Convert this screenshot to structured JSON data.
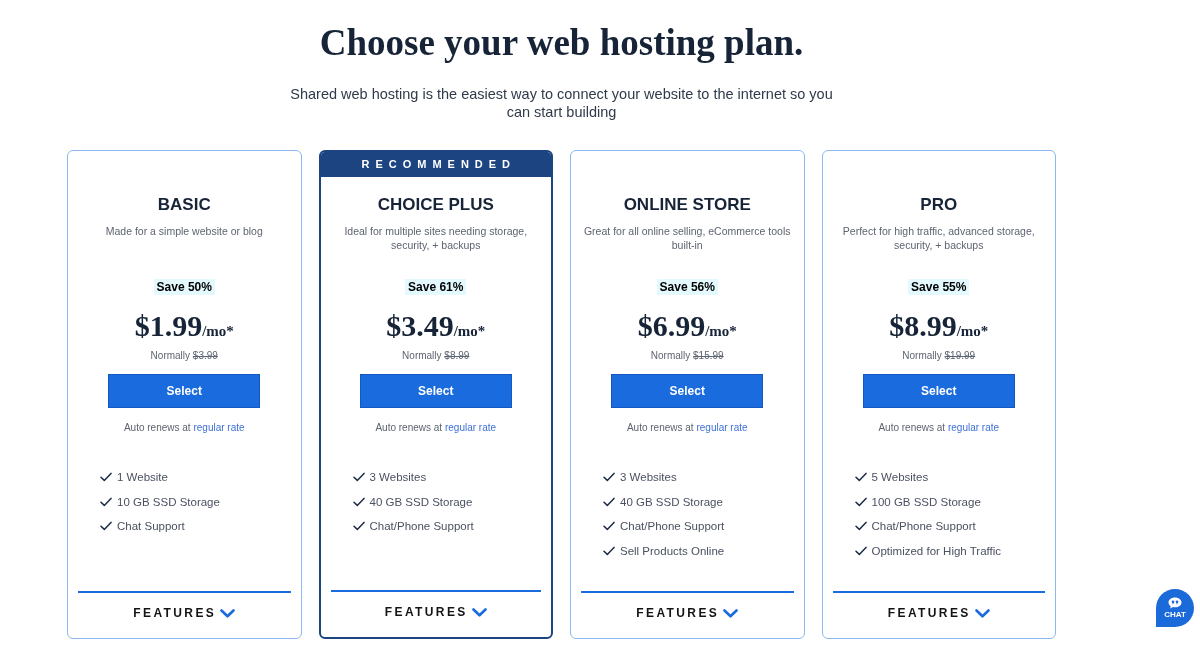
{
  "header": {
    "title": "Choose your web hosting plan.",
    "subtitle": "Shared web hosting is the easiest way to connect your website to the internet so you can start building"
  },
  "plans": [
    {
      "featured": false,
      "name": "BASIC",
      "description": "Made for a simple website or blog",
      "savings": "Save 50%",
      "price": "$1.99",
      "period": "/mo*",
      "normal_label": "Normally",
      "normal_price": "$3.99",
      "button": "Select",
      "renewal_note": "Auto renews at",
      "renewal_link": "regular rate",
      "features": [
        "1 Website",
        "10 GB SSD Storage",
        "Chat Support"
      ],
      "features_toggle": {
        "label": "FEATURES",
        "expanded": false
      }
    },
    {
      "featured": true,
      "ribbon": "RECOMMENDED",
      "name": "CHOICE PLUS",
      "description": "Ideal for multiple sites needing storage, security, + backups",
      "savings": "Save 61%",
      "price": "$3.49",
      "period": "/mo*",
      "normal_label": "Normally",
      "normal_price": "$8.99",
      "button": "Select",
      "renewal_note": "Auto renews at",
      "renewal_link": "regular rate",
      "features": [
        "3 Websites",
        "40 GB SSD Storage",
        "Chat/Phone Support"
      ],
      "features_toggle": {
        "label": "FEATURES",
        "expanded": false
      }
    },
    {
      "featured": false,
      "name": "ONLINE STORE",
      "description": "Great for all online selling, eCommerce tools built-in",
      "savings": "Save 56%",
      "price": "$6.99",
      "period": "/mo*",
      "normal_label": "Normally",
      "normal_price": "$15.99",
      "button": "Select",
      "renewal_note": "Auto renews at",
      "renewal_link": "regular rate",
      "features": [
        "3 Websites",
        "40 GB SSD Storage",
        "Chat/Phone Support",
        "Sell Products Online"
      ],
      "features_toggle": {
        "label": "FEATURES",
        "expanded": false
      }
    },
    {
      "featured": false,
      "name": "PRO",
      "description": "Perfect for high traffic, advanced storage, security, + backups",
      "savings": "Save 55%",
      "price": "$8.99",
      "period": "/mo*",
      "normal_label": "Normally",
      "normal_price": "$19.99",
      "button": "Select",
      "renewal_note": "Auto renews at",
      "renewal_link": "regular rate",
      "features": [
        "5 Websites",
        "100 GB SSD Storage",
        "Chat/Phone Support",
        "Optimized for High Traffic"
      ],
      "features_toggle": {
        "label": "FEATURES",
        "expanded": false
      }
    }
  ],
  "chat": {
    "label": "CHAT"
  }
}
